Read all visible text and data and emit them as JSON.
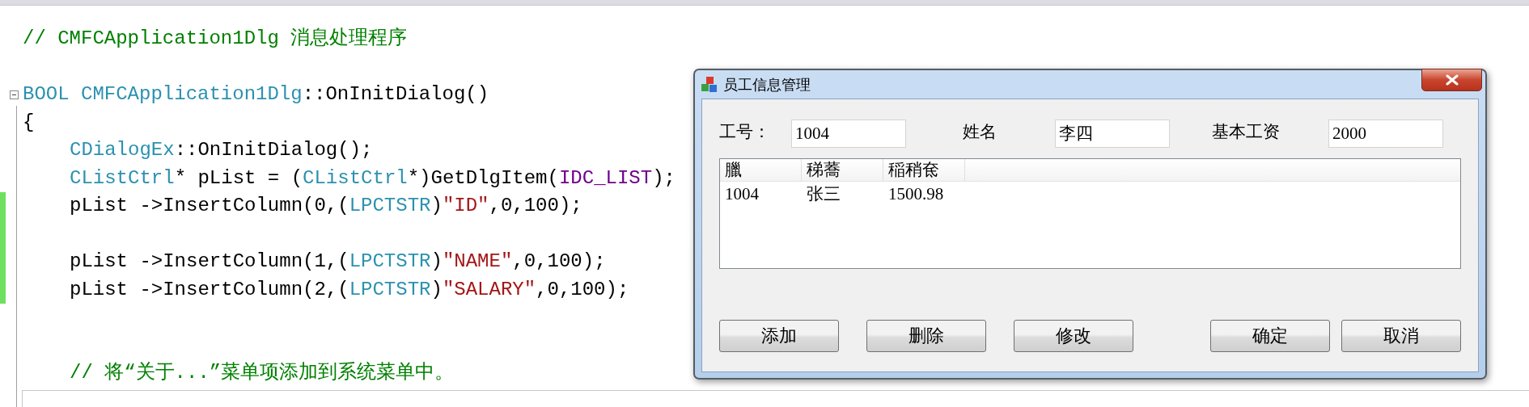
{
  "editor": {
    "lines": [
      {
        "kind": "code",
        "changed": false,
        "tokens": [
          {
            "kind": "comment",
            "text": "// CMFCApplication1Dlg 消息处理程序"
          }
        ]
      },
      {
        "kind": "blank",
        "changed": false
      },
      {
        "kind": "code",
        "changed": false,
        "tokens": [
          {
            "kind": "type",
            "text": "BOOL CMFCApplication1Dlg"
          },
          {
            "kind": "plain",
            "text": "::OnInitDialog()"
          }
        ]
      },
      {
        "kind": "code",
        "changed": false,
        "tokens": [
          {
            "kind": "plain",
            "text": "{"
          }
        ],
        "children": [
          {
            "kind": "code",
            "changed": false,
            "tokens": [
              {
                "kind": "type",
                "text": "CDialogEx"
              },
              {
                "kind": "plain",
                "text": "::OnInitDialog();"
              }
            ]
          },
          {
            "kind": "code",
            "changed": false,
            "tokens": [
              {
                "kind": "type",
                "text": "CListCtrl"
              },
              {
                "kind": "plain",
                "text": "* pList = ("
              },
              {
                "kind": "type",
                "text": "CListCtrl"
              },
              {
                "kind": "plain",
                "text": "*)GetDlgItem("
              },
              {
                "kind": "macro",
                "text": "IDC_LIST"
              },
              {
                "kind": "plain",
                "text": ");"
              }
            ]
          },
          {
            "kind": "code",
            "changed": true,
            "tokens": [
              {
                "kind": "plain",
                "text": "pList ->InsertColumn(0,("
              },
              {
                "kind": "type",
                "text": "LPCTSTR"
              },
              {
                "kind": "plain",
                "text": ")"
              },
              {
                "kind": "string",
                "text": "\"ID\""
              },
              {
                "kind": "plain",
                "text": ",0,100);"
              }
            ]
          },
          {
            "kind": "blank",
            "changed": true
          },
          {
            "kind": "code",
            "changed": true,
            "tokens": [
              {
                "kind": "plain",
                "text": "pList ->InsertColumn(1,("
              },
              {
                "kind": "type",
                "text": "LPCTSTR"
              },
              {
                "kind": "plain",
                "text": ")"
              },
              {
                "kind": "string",
                "text": "\"NAME\""
              },
              {
                "kind": "plain",
                "text": ",0,100);"
              }
            ]
          },
          {
            "kind": "code",
            "changed": true,
            "tokens": [
              {
                "kind": "plain",
                "text": "pList ->InsertColumn(2,("
              },
              {
                "kind": "type",
                "text": "LPCTSTR"
              },
              {
                "kind": "plain",
                "text": ")"
              },
              {
                "kind": "string",
                "text": "\"SALARY\""
              },
              {
                "kind": "plain",
                "text": ",0,100);"
              }
            ]
          },
          {
            "kind": "blank",
            "changed": false
          },
          {
            "kind": "blank",
            "changed": false
          },
          {
            "kind": "code",
            "changed": false,
            "tokens": [
              {
                "kind": "comment",
                "text": "// 将“关于...”菜单项添加到系统菜单中。"
              }
            ]
          }
        ]
      }
    ]
  },
  "dialog": {
    "title": "员工信息管理",
    "fields": [
      {
        "label": "工号：",
        "value": "1004"
      },
      {
        "label": "姓名",
        "value": "李四"
      },
      {
        "label": "基本工资",
        "value": "2000"
      }
    ],
    "table": {
      "columns": [
        "臘",
        "稊蕎",
        "稲稍奃"
      ],
      "rows": [
        [
          "1004",
          "张三",
          "1500.98"
        ]
      ]
    },
    "buttons_left": [
      "添加",
      "删除",
      "修改"
    ],
    "buttons_right": [
      "确定",
      "取消"
    ]
  }
}
